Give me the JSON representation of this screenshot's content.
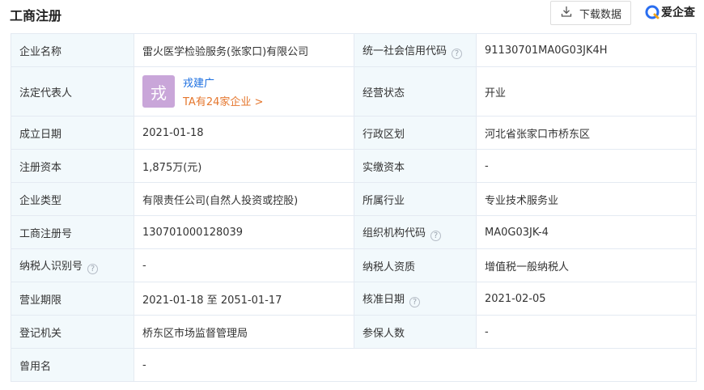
{
  "header": {
    "title": "工商注册",
    "download_label": "下载数据",
    "logo_text": "爱企查"
  },
  "colors": {
    "accent_blue": "#1a6ee0",
    "accent_orange": "#e5772e",
    "label_bg": "#f2f9fc"
  },
  "rows": {
    "r0": {
      "l1": "企业名称",
      "v1": "雷火医学检验服务(张家口)有限公司",
      "l2": "统一社会信用代码",
      "v2": "91130701MA0G03JK4H"
    },
    "r1": {
      "l1": "法定代表人",
      "avatar_char": "戎",
      "rep_name": "戎建广",
      "rep_link": "TA有24家企业 >",
      "l2": "经营状态",
      "v2": "开业"
    },
    "r2": {
      "l1": "成立日期",
      "v1": "2021-01-18",
      "l2": "行政区划",
      "v2": "河北省张家口市桥东区"
    },
    "r3": {
      "l1": "注册资本",
      "v1": "1,875万(元)",
      "l2": "实缴资本",
      "v2": "-"
    },
    "r4": {
      "l1": "企业类型",
      "v1": "有限责任公司(自然人投资或控股)",
      "l2": "所属行业",
      "v2": "专业技术服务业"
    },
    "r5": {
      "l1": "工商注册号",
      "v1": "130701000128039",
      "l2": "组织机构代码",
      "v2": "MA0G03JK-4"
    },
    "r6": {
      "l1": "纳税人识别号",
      "v1": "-",
      "l2": "纳税人资质",
      "v2": "增值税一般纳税人"
    },
    "r7": {
      "l1": "营业期限",
      "v1": "2021-01-18 至 2051-01-17",
      "l2": "核准日期",
      "v2": "2021-02-05"
    },
    "r8": {
      "l1": "登记机关",
      "v1": "桥东区市场监督管理局",
      "l2": "参保人数",
      "v2": "-"
    },
    "r9": {
      "l1": "曾用名",
      "v1": "-"
    }
  },
  "help_glyph": "?"
}
